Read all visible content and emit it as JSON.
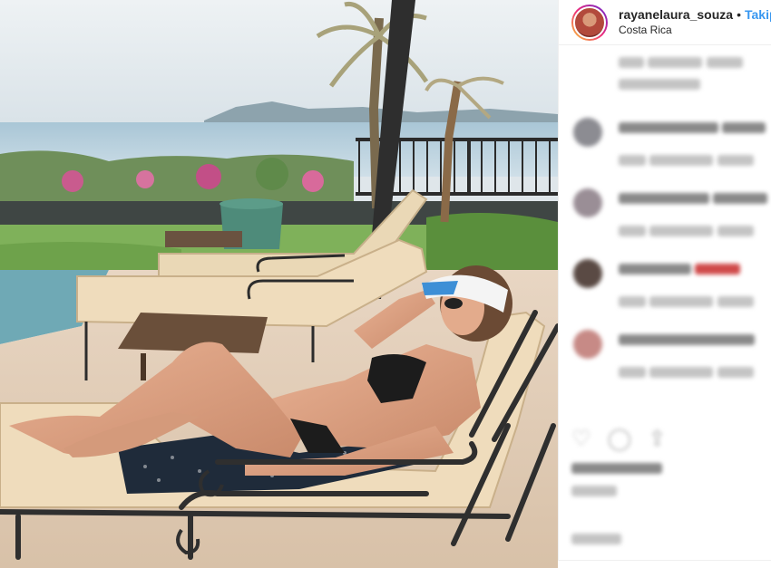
{
  "post": {
    "username": "rayanelaura_souza",
    "separator": "•",
    "follow_label": "Takip",
    "location": "Costa Rica"
  },
  "comments_section": {
    "comments_blurred": true,
    "comment_count_visible": 5
  },
  "colors": {
    "follow_blue": "#3897f0",
    "text_dark": "#262626",
    "panel_border": "#efefef"
  },
  "icons": [
    "heart-icon",
    "comment-icon",
    "share-icon"
  ]
}
